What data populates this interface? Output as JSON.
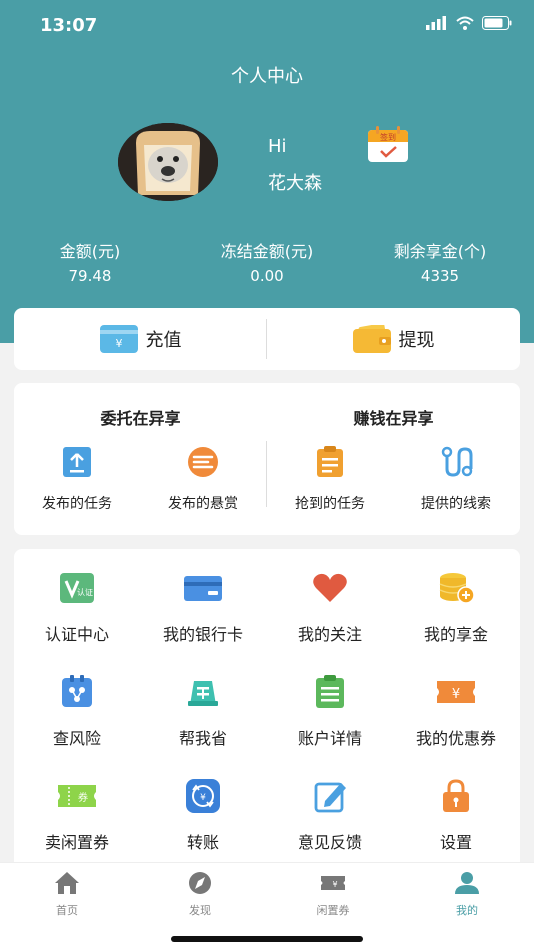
{
  "status_bar": {
    "time": "13:07"
  },
  "header": {
    "title": "个人中心",
    "greeting": "Hi",
    "username": "花大森",
    "signin_badge": "签到"
  },
  "stats": [
    {
      "label": "金额(元)",
      "value": "79.48"
    },
    {
      "label": "冻结金额(元)",
      "value": "0.00"
    },
    {
      "label": "剩余享金(个)",
      "value": "4335"
    }
  ],
  "actions": {
    "recharge": "充值",
    "withdraw": "提现",
    "yen": "¥"
  },
  "sections": {
    "entrust": {
      "title": "委托在异享",
      "items": [
        "发布的任务",
        "发布的悬赏"
      ]
    },
    "earn": {
      "title": "赚钱在异享",
      "items": [
        "抢到的任务",
        "提供的线索"
      ]
    }
  },
  "grid": [
    {
      "label": "认证中心",
      "icon": "certification-icon"
    },
    {
      "label": "我的银行卡",
      "icon": "bank-card-icon"
    },
    {
      "label": "我的关注",
      "icon": "heart-icon"
    },
    {
      "label": "我的享金",
      "icon": "coins-icon"
    },
    {
      "label": "查风险",
      "icon": "risk-check-icon"
    },
    {
      "label": "帮我省",
      "icon": "save-money-icon"
    },
    {
      "label": "账户详情",
      "icon": "account-details-icon"
    },
    {
      "label": "我的优惠券",
      "icon": "coupon-icon"
    },
    {
      "label": "卖闲置券",
      "icon": "sell-coupon-icon"
    },
    {
      "label": "转账",
      "icon": "transfer-icon"
    },
    {
      "label": "意见反馈",
      "icon": "feedback-icon"
    },
    {
      "label": "设置",
      "icon": "settings-lock-icon"
    }
  ],
  "icon_text": {
    "cert": "认证",
    "coupon": "券",
    "yen": "¥"
  },
  "tabs": [
    {
      "label": "首页",
      "icon": "home-icon"
    },
    {
      "label": "发现",
      "icon": "compass-icon"
    },
    {
      "label": "闲置券",
      "icon": "ticket-icon"
    },
    {
      "label": "我的",
      "icon": "person-icon"
    }
  ],
  "colors": {
    "primary": "#4a9ea6",
    "accent_orange": "#f0a030",
    "accent_blue": "#4aa0e0",
    "accent_red": "#e05a40",
    "accent_green": "#5cb85c"
  }
}
